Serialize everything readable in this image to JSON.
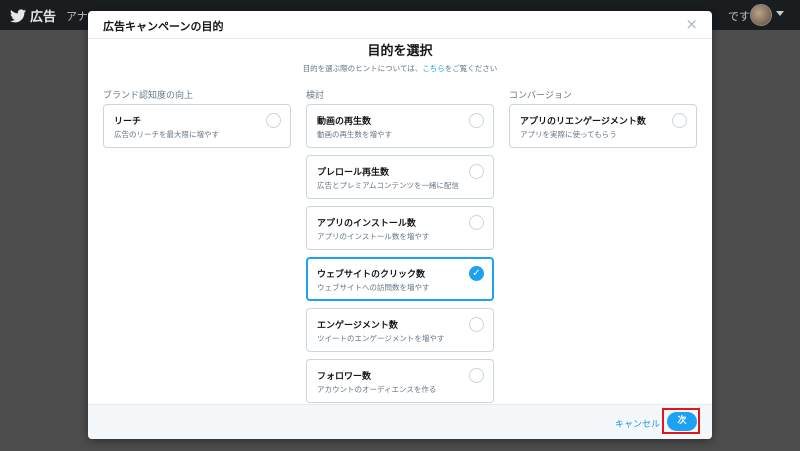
{
  "app": {
    "brand": "広告",
    "nav_partial": "アナ",
    "nav_right_partial": "です"
  },
  "modal": {
    "title": "広告キャンペーンの目的",
    "close_symbol": "×",
    "heading": "目的を選択",
    "hint_before": "目的を選ぶ際のヒントについては、",
    "hint_link": "こちら",
    "hint_after": "をご覧ください"
  },
  "columns": [
    {
      "title": "ブランド認知度の向上",
      "cards": [
        {
          "title": "リーチ",
          "desc": "広告のリーチを最大限に増やす",
          "selected": false
        }
      ]
    },
    {
      "title": "検討",
      "cards": [
        {
          "title": "動画の再生数",
          "desc": "動画の再生数を増やす",
          "selected": false
        },
        {
          "title": "プレロール再生数",
          "desc": "広告とプレミアムコンテンツを一緒に配信",
          "selected": false
        },
        {
          "title": "アプリのインストール数",
          "desc": "アプリのインストール数を増やす",
          "selected": false
        },
        {
          "title": "ウェブサイトのクリック数",
          "desc": "ウェブサイトへの訪問数を増やす",
          "selected": true
        },
        {
          "title": "エンゲージメント数",
          "desc": "ツイートのエンゲージメントを増やす",
          "selected": false
        },
        {
          "title": "フォロワー数",
          "desc": "アカウントのオーディエンスを作る",
          "selected": false
        }
      ]
    },
    {
      "title": "コンバージョン",
      "cards": [
        {
          "title": "アプリのリエンゲージメント数",
          "desc": "アプリを実際に使ってもらう",
          "selected": false
        }
      ]
    }
  ],
  "footer": {
    "cancel_label": "キャンセル",
    "next_label": "次"
  },
  "icons": {
    "brand": "bird-icon",
    "check": "checkmark-icon"
  },
  "colors": {
    "accent": "#1da1f2",
    "link": "#1b95e0",
    "highlight": "#e0161b"
  }
}
